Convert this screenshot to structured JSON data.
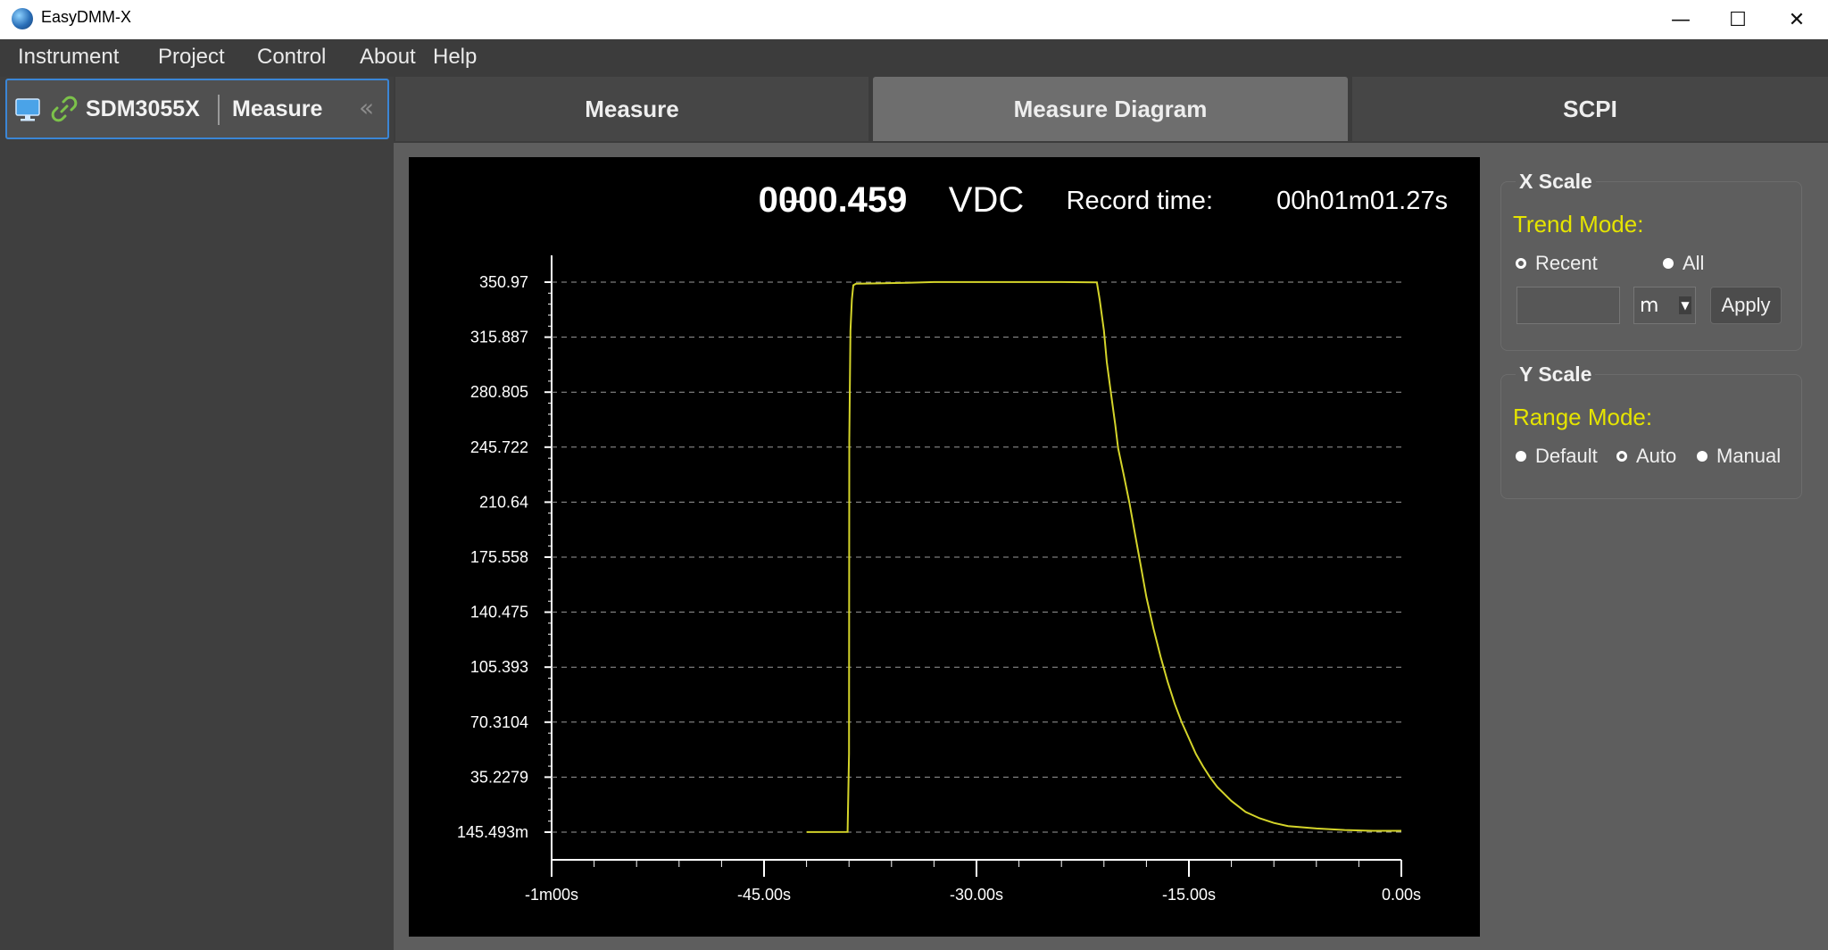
{
  "window": {
    "title": "EasyDMM-X",
    "controls": {
      "minimize": "—",
      "maximize": "☐",
      "close": "✕"
    }
  },
  "menu": [
    "Instrument",
    "Project",
    "Control",
    "About",
    "Help"
  ],
  "device": {
    "name": "SDM3055X",
    "view": "Measure",
    "collapse": "«"
  },
  "tabs": [
    {
      "label": "Measure",
      "active": false
    },
    {
      "label": "Measure Diagram",
      "active": true
    },
    {
      "label": "SCPI",
      "active": false
    }
  ],
  "readout": {
    "sign": "+",
    "value": "0000.459",
    "unit": "VDC",
    "record_label": "Record time:",
    "record_time": "00h01m01.27s"
  },
  "chart_data": {
    "type": "line",
    "title": "",
    "xlabel": "",
    "ylabel": "",
    "xlim": [
      -60,
      0
    ],
    "ylim": [
      0.145493,
      350.97
    ],
    "y_ticks": [
      "350.97",
      "315.887",
      "280.805",
      "245.722",
      "210.64",
      "175.558",
      "140.475",
      "105.393",
      "70.3104",
      "35.2279",
      "145.493m"
    ],
    "x_ticks": [
      "-1m00s",
      "-45.00s",
      "-30.00s",
      "-15.00s",
      "0.00s"
    ],
    "x_tick_values": [
      -60,
      -45,
      -30,
      -15,
      0
    ],
    "grid": true,
    "line_color": "#d4d42a",
    "series": [
      {
        "x": [
          -42.0,
          -39.1,
          -39.0,
          -38.98,
          -38.9,
          -38.8,
          -38.7,
          -38.5,
          -37.0,
          -35.0,
          -33.0,
          -30.0,
          -27.0,
          -24.0,
          -21.5,
          -21.3,
          -21.0,
          -20.8,
          -20.5,
          -20.2,
          -20.0,
          -19.6,
          -19.2,
          -18.8,
          -18.4,
          -18.0,
          -17.5,
          -17.0,
          -16.5,
          -16.0,
          -15.5,
          -15.0,
          -14.5,
          -14.0,
          -13.5,
          -13.0,
          -12.0,
          -11.0,
          -10.0,
          -9.0,
          -8.0,
          -6.0,
          -4.0,
          -2.0,
          0.0
        ],
        "y": [
          0.2,
          0.3,
          50,
          250,
          320,
          340,
          349,
          350,
          350.2,
          350.5,
          351,
          351,
          351,
          351,
          350.8,
          340,
          320,
          300,
          280,
          260,
          245,
          228,
          210,
          190,
          170,
          150,
          130,
          112,
          96,
          82,
          70,
          60,
          50,
          42,
          35,
          29,
          20,
          13,
          9,
          6,
          4,
          2.5,
          1.5,
          1,
          1
        ]
      }
    ]
  },
  "x_scale": {
    "title": "X Scale",
    "mode_label": "Trend Mode:",
    "options": [
      {
        "label": "Recent",
        "selected": true
      },
      {
        "label": "All",
        "selected": false
      }
    ],
    "value": "",
    "unit": "m",
    "apply_label": "Apply"
  },
  "y_scale": {
    "title": "Y Scale",
    "mode_label": "Range Mode:",
    "options": [
      {
        "label": "Default",
        "selected": false
      },
      {
        "label": "Auto",
        "selected": true
      },
      {
        "label": "Manual",
        "selected": false
      }
    ]
  }
}
